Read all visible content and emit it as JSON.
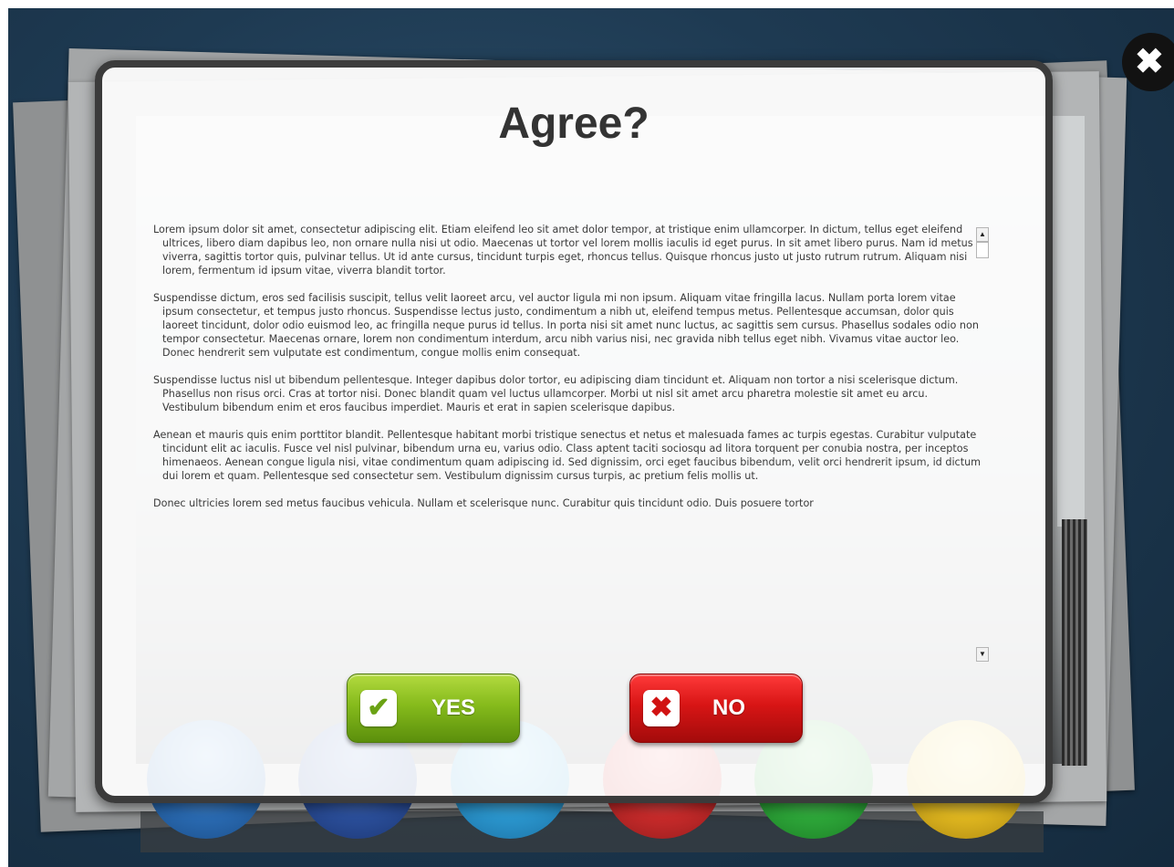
{
  "dialog": {
    "title": "Agree?",
    "close_icon": "close-icon",
    "close_glyph": "✖",
    "terms_paragraphs": [
      "Lorem ipsum dolor sit amet, consectetur adipiscing elit. Etiam eleifend leo sit amet dolor tempor, at tristique enim ullamcorper. In dictum, tellus eget eleifend ultrices, libero diam dapibus leo, non ornare nulla nisi ut odio. Maecenas ut tortor vel lorem mollis iaculis id eget purus. In sit amet libero purus. Nam id metus viverra, sagittis tortor quis, pulvinar tellus. Ut id ante cursus, tincidunt turpis eget, rhoncus tellus. Quisque rhoncus justo ut justo rutrum rutrum. Aliquam nisi lorem, fermentum id ipsum vitae, viverra blandit tortor.",
      "Suspendisse dictum, eros sed facilisis suscipit, tellus velit laoreet arcu, vel auctor ligula mi non ipsum. Aliquam vitae fringilla lacus. Nullam porta lorem vitae ipsum consectetur, et tempus justo rhoncus. Suspendisse lectus justo, condimentum a nibh ut, eleifend tempus metus. Pellentesque accumsan, dolor quis laoreet tincidunt, dolor odio euismod leo, ac fringilla neque purus id tellus. In porta nisi sit amet nunc luctus, ac sagittis sem cursus. Phasellus sodales odio non tempor consectetur. Maecenas ornare, lorem non condimentum interdum, arcu nibh varius nisi, nec gravida nibh tellus eget nibh. Vivamus vitae auctor leo. Donec hendrerit sem vulputate est condimentum, congue mollis enim consequat.",
      "Suspendisse luctus nisl ut bibendum pellentesque. Integer dapibus dolor tortor, eu adipiscing diam tincidunt et. Aliquam non tortor a nisi scelerisque dictum. Phasellus non risus orci. Cras at tortor nisi. Donec blandit quam vel luctus ullamcorper. Morbi ut nisl sit amet arcu pharetra molestie sit amet eu arcu. Vestibulum bibendum enim et eros faucibus imperdiet. Mauris et erat in sapien scelerisque dapibus.",
      "Aenean et mauris quis enim porttitor blandit. Pellentesque habitant morbi tristique senectus et netus et malesuada fames ac turpis egestas. Curabitur vulputate tincidunt elit ac iaculis. Fusce vel nisl pulvinar, bibendum urna eu, varius odio. Class aptent taciti sociosqu ad litora torquent per conubia nostra, per inceptos himenaeos. Aenean congue ligula nisi, vitae condimentum quam adipiscing id. Sed dignissim, orci eget faucibus bibendum, velit orci hendrerit ipsum, id dictum dui lorem et quam. Pellentesque sed consectetur sem. Vestibulum dignissim cursus turpis, ac pretium felis mollis ut.",
      "Donec ultricies lorem sed metus faucibus vehicula. Nullam et scelerisque nunc. Curabitur quis tincidunt odio. Duis posuere tortor"
    ],
    "scrollbar": {
      "up_glyph": "▲",
      "down_glyph": "▼"
    },
    "yes_button": {
      "label": "YES",
      "icon": "checkmark-icon",
      "glyph": "✔"
    },
    "no_button": {
      "label": "NO",
      "icon": "x-icon",
      "glyph": "✖"
    }
  },
  "colors": {
    "background": "#1e3a52",
    "yes": "#7fb51a",
    "no": "#d81515",
    "title": "#333333"
  }
}
